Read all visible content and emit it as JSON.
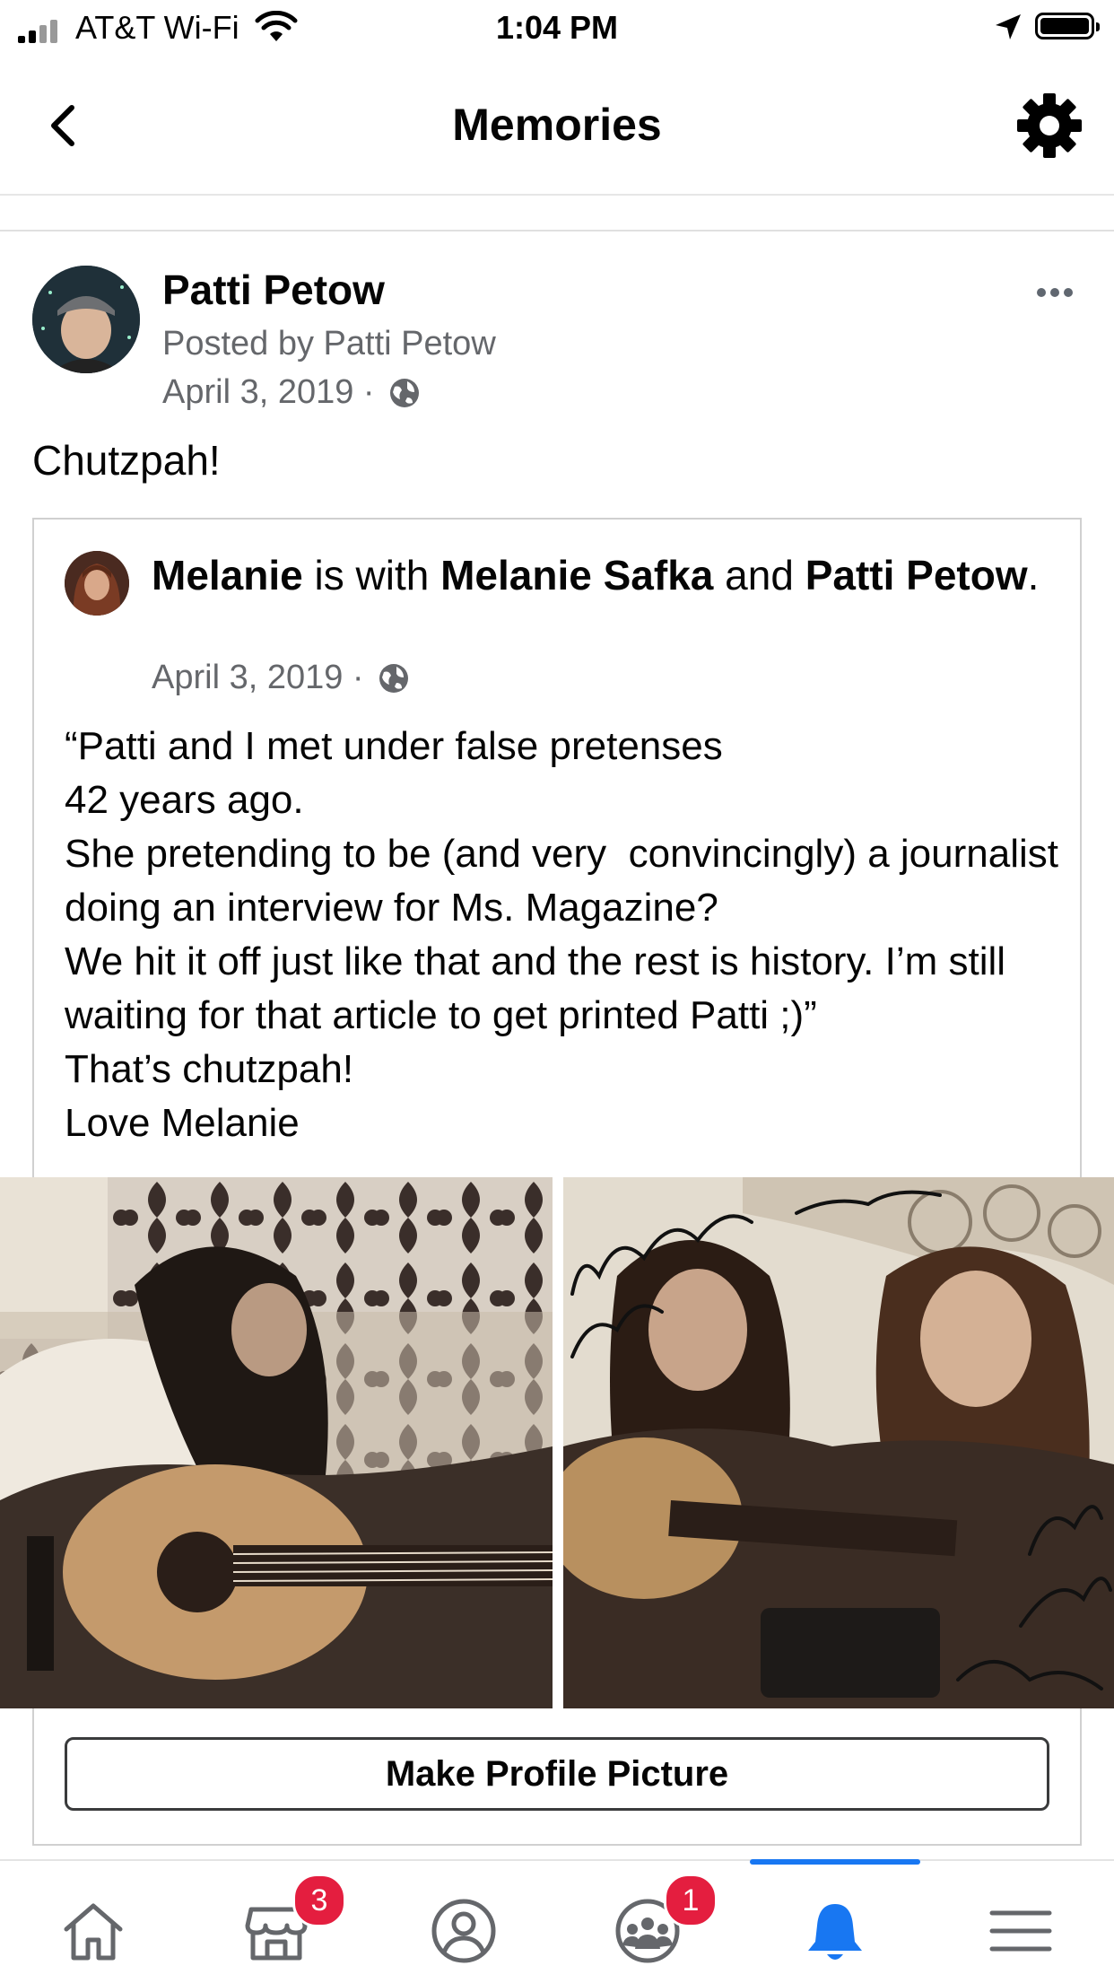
{
  "status_bar": {
    "carrier": "AT&T Wi-Fi",
    "time": "1:04 PM"
  },
  "header": {
    "title": "Memories"
  },
  "post": {
    "author": "Patti Petow",
    "posted_by": "Posted by Patti Petow",
    "date": "April 3, 2019 ·",
    "text": "Chutzpah!"
  },
  "shared": {
    "author": "Melanie",
    "with_text": " is with ",
    "tagged1": "Melanie Safka",
    "and_text": " and ",
    "tagged2": "Patti Petow",
    "period": ".",
    "date": "April 3, 2019 ·",
    "text": "“Patti and I met under false pretenses\n42 years ago.\nShe pretending to be (and very  convincingly) a journalist doing an interview for Ms. Magazine?\nWe hit it off just like that and the rest is history. I’m still waiting for that article to get printed Patti ;)”\nThat’s chutzpah!\nLove Melanie"
  },
  "action": {
    "make_profile_picture": "Make Profile Picture"
  },
  "tabbar": {
    "items": [
      {
        "icon": "home-icon",
        "badge": ""
      },
      {
        "icon": "marketplace-icon",
        "badge": "3"
      },
      {
        "icon": "profile-icon",
        "badge": ""
      },
      {
        "icon": "groups-icon",
        "badge": "1"
      },
      {
        "icon": "notifications-icon",
        "badge": "",
        "active": true
      },
      {
        "icon": "menu-icon",
        "badge": ""
      }
    ]
  },
  "colors": {
    "accent": "#1877f2",
    "badge": "#e41e3f",
    "secondary_text": "#65676b"
  }
}
